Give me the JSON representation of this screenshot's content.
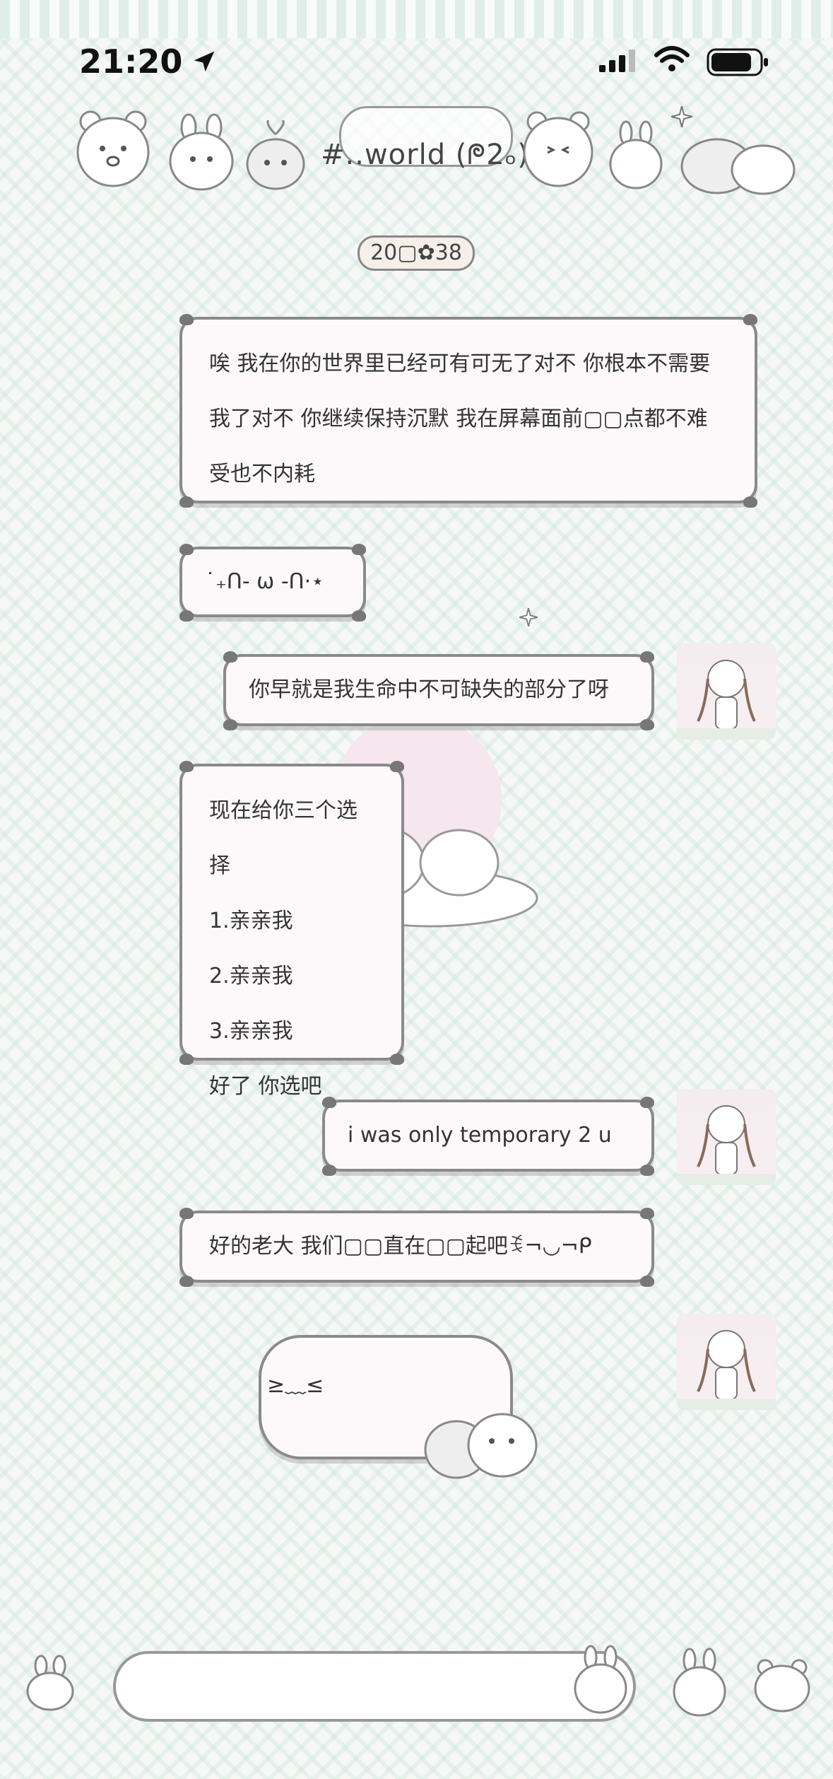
{
  "status_bar": {
    "time": "21:20"
  },
  "header": {
    "title": "#..world (ᖘ2ₒ)"
  },
  "timestamp": "20▢✿38",
  "messages": [
    {
      "side": "left",
      "lines": [
        "唉 我在你的世界里已经可有可无了对不 你根本不需要",
        "我了对不 你继续保持沉默 我在屏幕面前▢▢点都不难",
        "受也不内耗"
      ]
    },
    {
      "side": "left",
      "lines": [
        "˙₊ᑎ- ω -ᑎ·⋆"
      ]
    },
    {
      "side": "right",
      "lines": [
        "你早就是我生命中不可缺失的部分了呀"
      ]
    },
    {
      "side": "left",
      "lines": [
        "现在给你三个选择",
        "1.亲亲我",
        "2.亲亲我",
        "3.亲亲我",
        "好了 你选吧"
      ]
    },
    {
      "side": "right",
      "lines": [
        "i was only temporary 2 u"
      ]
    },
    {
      "side": "left",
      "lines": [
        "好的老大 我们▢▢直在▢▢起吧ꉂ¬◡¬ᑭ"
      ]
    },
    {
      "side": "right",
      "lines": [
        "≥﹏≤"
      ]
    }
  ],
  "input": {
    "placeholder": ""
  },
  "icons": {
    "location": "location-arrow-icon",
    "signal": "signal-bars-icon",
    "wifi": "wifi-icon",
    "battery": "battery-icon"
  }
}
